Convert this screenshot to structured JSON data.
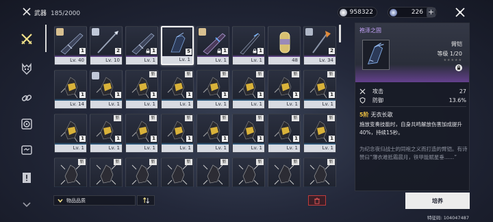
{
  "header": {
    "title": "武器",
    "count": "185/2000",
    "currency_value": "958322",
    "stamina_value": "226",
    "plus_label": "+"
  },
  "sidebar": {
    "items": [
      {
        "name": "weapon"
      },
      {
        "name": "mask"
      },
      {
        "name": "link"
      },
      {
        "name": "module"
      },
      {
        "name": "chip"
      },
      {
        "name": "document"
      },
      {
        "name": "more"
      }
    ]
  },
  "inventory": {
    "cards": [
      {
        "art": "rifle",
        "rarity": "pur",
        "qty": "1",
        "lv": "Lv. 40",
        "lock": false,
        "new": false,
        "avatar": true
      },
      {
        "art": "spear",
        "rarity": "pur",
        "qty": "2",
        "lv": "Lv. 10",
        "lock": false,
        "new": false,
        "avatar": true
      },
      {
        "art": "rifle",
        "rarity": "pur",
        "qty": "1",
        "lv": "Lv. 1",
        "lock": true,
        "new": false,
        "avatar": false
      },
      {
        "art": "gauntlet",
        "rarity": "pur",
        "qty": "5",
        "lv": "Lv. 1",
        "lock": false,
        "new": false,
        "avatar": false,
        "selected": true
      },
      {
        "art": "rifle2",
        "rarity": "pur",
        "qty": "1",
        "lv": "Lv. 1",
        "lock": true,
        "new": false,
        "avatar": true
      },
      {
        "art": "blade",
        "rarity": "pur",
        "qty": "1",
        "lv": "Lv. 1",
        "lock": true,
        "new": false,
        "avatar": false
      },
      {
        "art": "capsule",
        "rarity": "pur",
        "qty": "",
        "lv": "48",
        "lock": false,
        "new": false,
        "avatar": false
      },
      {
        "art": "halberd",
        "rarity": "pur",
        "qty": "2",
        "lv": "Lv. 34",
        "lock": false,
        "new": false,
        "avatar": true
      },
      {
        "art": "claw",
        "rarity": "blu",
        "qty": "1",
        "lv": "Lv. 14",
        "lock": false,
        "new": false,
        "avatar": false
      },
      {
        "art": "claw",
        "rarity": "blu",
        "qty": "1",
        "lv": "Lv. 1",
        "lock": false,
        "new": false,
        "avatar": true
      },
      {
        "art": "claw",
        "rarity": "blu",
        "qty": "1",
        "lv": "Lv. 1",
        "lock": false,
        "new": true,
        "avatar": false
      },
      {
        "art": "claw",
        "rarity": "blu",
        "qty": "1",
        "lv": "Lv. 1",
        "lock": false,
        "new": true,
        "avatar": false
      },
      {
        "art": "claw",
        "rarity": "blu",
        "qty": "1",
        "lv": "Lv. 1",
        "lock": false,
        "new": true,
        "avatar": false
      },
      {
        "art": "claw",
        "rarity": "blu",
        "qty": "1",
        "lv": "Lv. 1",
        "lock": false,
        "new": true,
        "avatar": false
      },
      {
        "art": "claw",
        "rarity": "blu",
        "qty": "1",
        "lv": "Lv. 1",
        "lock": false,
        "new": true,
        "avatar": false
      },
      {
        "art": "claw",
        "rarity": "blu",
        "qty": "1",
        "lv": "Lv. 1",
        "lock": false,
        "new": true,
        "avatar": false
      },
      {
        "art": "claw",
        "rarity": "blu",
        "qty": "1",
        "lv": "Lv. 1",
        "lock": false,
        "new": false,
        "avatar": false
      },
      {
        "art": "claw",
        "rarity": "blu",
        "qty": "1",
        "lv": "Lv. 1",
        "lock": false,
        "new": true,
        "avatar": false
      },
      {
        "art": "claw",
        "rarity": "blu",
        "qty": "1",
        "lv": "Lv. 1",
        "lock": false,
        "new": true,
        "avatar": false
      },
      {
        "art": "claw",
        "rarity": "blu",
        "qty": "1",
        "lv": "Lv. 1",
        "lock": false,
        "new": true,
        "avatar": false
      },
      {
        "art": "claw",
        "rarity": "blu",
        "qty": "1",
        "lv": "Lv. 1",
        "lock": false,
        "new": true,
        "avatar": false
      },
      {
        "art": "claw",
        "rarity": "blu",
        "qty": "1",
        "lv": "Lv. 1",
        "lock": false,
        "new": true,
        "avatar": false
      },
      {
        "art": "claw",
        "rarity": "blu",
        "qty": "1",
        "lv": "Lv. 1",
        "lock": false,
        "new": true,
        "avatar": false
      },
      {
        "art": "claw",
        "rarity": "blu",
        "qty": "1",
        "lv": "Lv. 1",
        "lock": false,
        "new": true,
        "avatar": false
      },
      {
        "art": "claw2",
        "rarity": "blu",
        "qty": "",
        "lv": "",
        "lock": false,
        "new": true,
        "avatar": false
      },
      {
        "art": "claw2",
        "rarity": "blu",
        "qty": "",
        "lv": "",
        "lock": false,
        "new": true,
        "avatar": false
      },
      {
        "art": "claw2",
        "rarity": "blu",
        "qty": "",
        "lv": "",
        "lock": false,
        "new": true,
        "avatar": false
      },
      {
        "art": "claw2",
        "rarity": "blu",
        "qty": "",
        "lv": "",
        "lock": false,
        "new": true,
        "avatar": false
      },
      {
        "art": "claw2",
        "rarity": "blu",
        "qty": "",
        "lv": "",
        "lock": false,
        "new": true,
        "avatar": false
      },
      {
        "art": "claw2",
        "rarity": "blu",
        "qty": "",
        "lv": "",
        "lock": false,
        "new": true,
        "avatar": false
      },
      {
        "art": "claw2",
        "rarity": "blu",
        "qty": "",
        "lv": "",
        "lock": false,
        "new": true,
        "avatar": false
      },
      {
        "art": "claw2",
        "rarity": "blu",
        "qty": "",
        "lv": "",
        "lock": false,
        "new": true,
        "avatar": false
      }
    ],
    "new_label": "新"
  },
  "bottom": {
    "sort_label": "物品品质"
  },
  "detail": {
    "name": "袍泽之固",
    "type": "臂铠",
    "level": "等级 1/20",
    "stars": "★★★★★",
    "stats": [
      {
        "label": "攻击",
        "value": "27"
      },
      {
        "label": "防御",
        "value": "13.6%"
      }
    ],
    "skill_tier": "5阶",
    "skill_name": "无衣长歌",
    "skill_desc": "施放变奏技能时，自身共鸣解放伤害加成提升40%，持续15秒。",
    "lore": "为纪念夜归战士的同袍之义而打造的臂铠。有诗赞曰“薄衣难抵霜晨月，铁甲能赋星垂......”"
  },
  "actions": {
    "cultivate_label": "培养"
  },
  "footer": {
    "uid": "特征码: 104047487"
  },
  "colors": {
    "purple_rarity": "#a25ee0",
    "blue_rarity": "#49a4e0",
    "skill_tier": "#f5c542",
    "trash_border": "#c03b3b"
  }
}
